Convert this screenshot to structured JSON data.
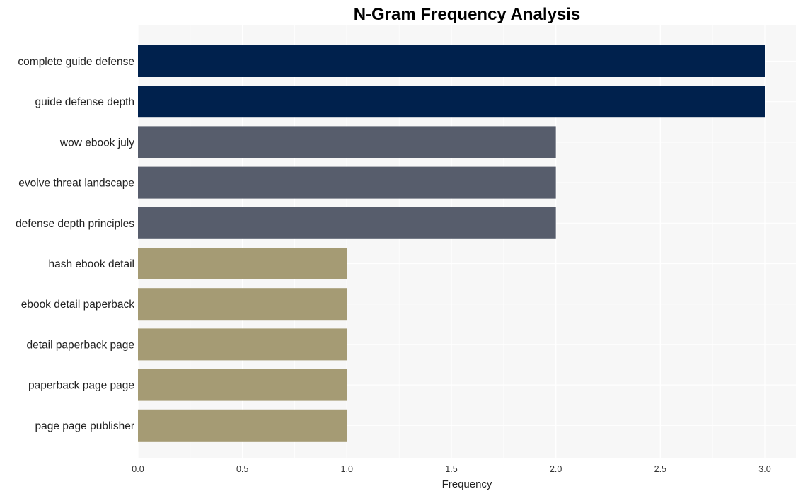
{
  "chart_data": {
    "type": "bar",
    "orientation": "horizontal",
    "title": "N-Gram Frequency Analysis",
    "xlabel": "Frequency",
    "ylabel": "",
    "xlim": [
      0,
      3.15
    ],
    "x_ticks": [
      0.0,
      0.5,
      1.0,
      1.5,
      2.0,
      2.5,
      3.0
    ],
    "x_tick_labels": [
      "0.0",
      "0.5",
      "1.0",
      "1.5",
      "2.0",
      "2.5",
      "3.0"
    ],
    "grid": true,
    "legend": null,
    "categories": [
      "complete guide defense",
      "guide defense depth",
      "wow ebook july",
      "evolve threat landscape",
      "defense depth principles",
      "hash ebook detail",
      "ebook detail paperback",
      "detail paperback page",
      "paperback page page",
      "page page publisher"
    ],
    "values": [
      3,
      3,
      2,
      2,
      2,
      1,
      1,
      1,
      1,
      1
    ],
    "colors": {
      "3": "#00214d",
      "2": "#575d6c",
      "1": "#a59b74"
    },
    "plot_background": "#f7f7f7",
    "grid_color": "#ffffff"
  }
}
